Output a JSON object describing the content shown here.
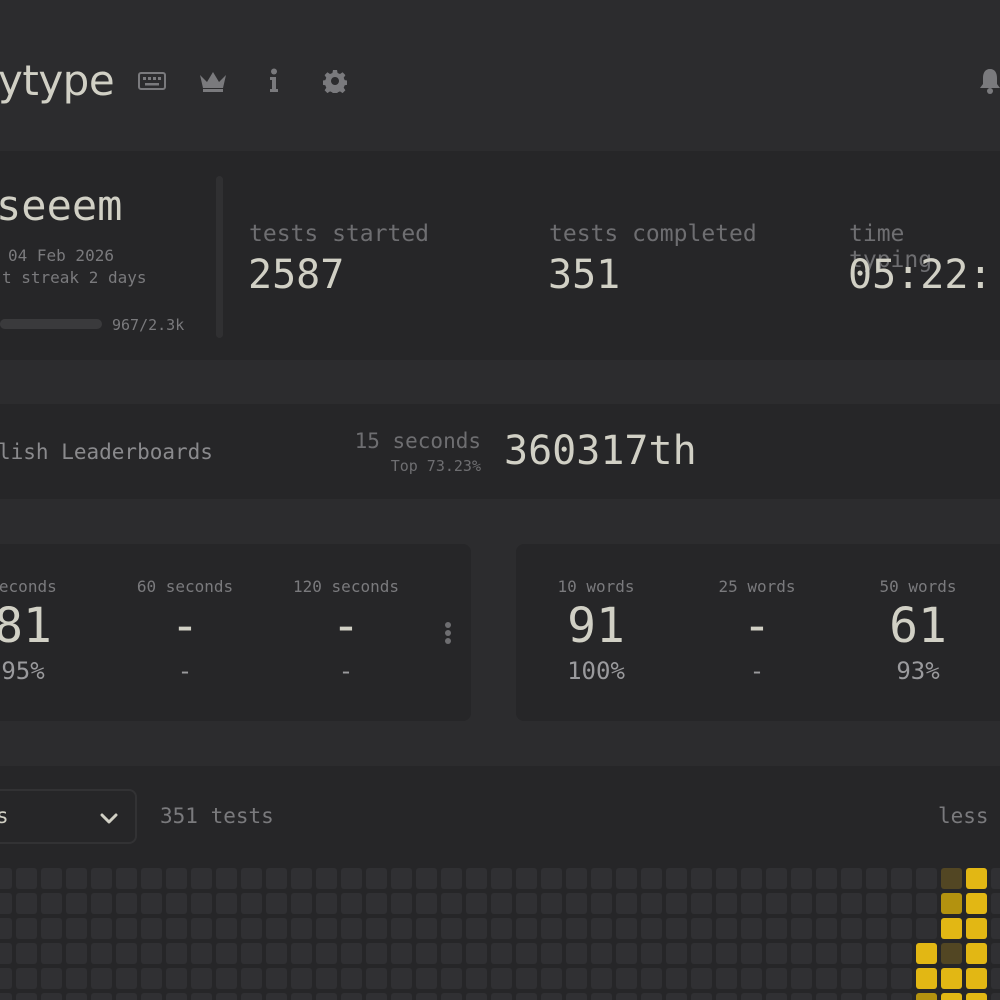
{
  "header": {
    "logo_text": "ytype",
    "icons": [
      "keyboard-icon",
      "crown-icon",
      "info-icon",
      "gear-icon",
      "bell-icon"
    ]
  },
  "profile": {
    "username": "seeem",
    "joined": "04 Feb 2026",
    "streak": "t streak 2 days",
    "xp_progress": 0.42,
    "xp_text": "967/2.3k"
  },
  "stats": [
    {
      "label": "tests started",
      "value": "2587"
    },
    {
      "label": "tests completed",
      "value": "351"
    },
    {
      "label": "time typing",
      "value": "05:22:"
    }
  ],
  "leaderboard": {
    "label": "lish Leaderboards",
    "mode": "15 seconds",
    "top": "Top 73.23%",
    "rank": "360317th"
  },
  "personal_bests_time": [
    {
      "label": "seconds",
      "wpm": "81",
      "acc": "95%"
    },
    {
      "label": "60 seconds",
      "wpm": "-",
      "acc": "-"
    },
    {
      "label": "120 seconds",
      "wpm": "-",
      "acc": "-"
    }
  ],
  "personal_bests_words": [
    {
      "label": "10 words",
      "wpm": "91",
      "acc": "100%"
    },
    {
      "label": "25 words",
      "wpm": "-",
      "acc": "-"
    },
    {
      "label": "50 words",
      "wpm": "61",
      "acc": "93%"
    }
  ],
  "activity": {
    "select_value": "s",
    "tests_count": "351 tests",
    "legend_less": "less"
  },
  "colors": {
    "accent": "#e2b714",
    "accent_mid": "#b3920f",
    "accent_dim": "#524623",
    "cell_empty": "#303033"
  }
}
